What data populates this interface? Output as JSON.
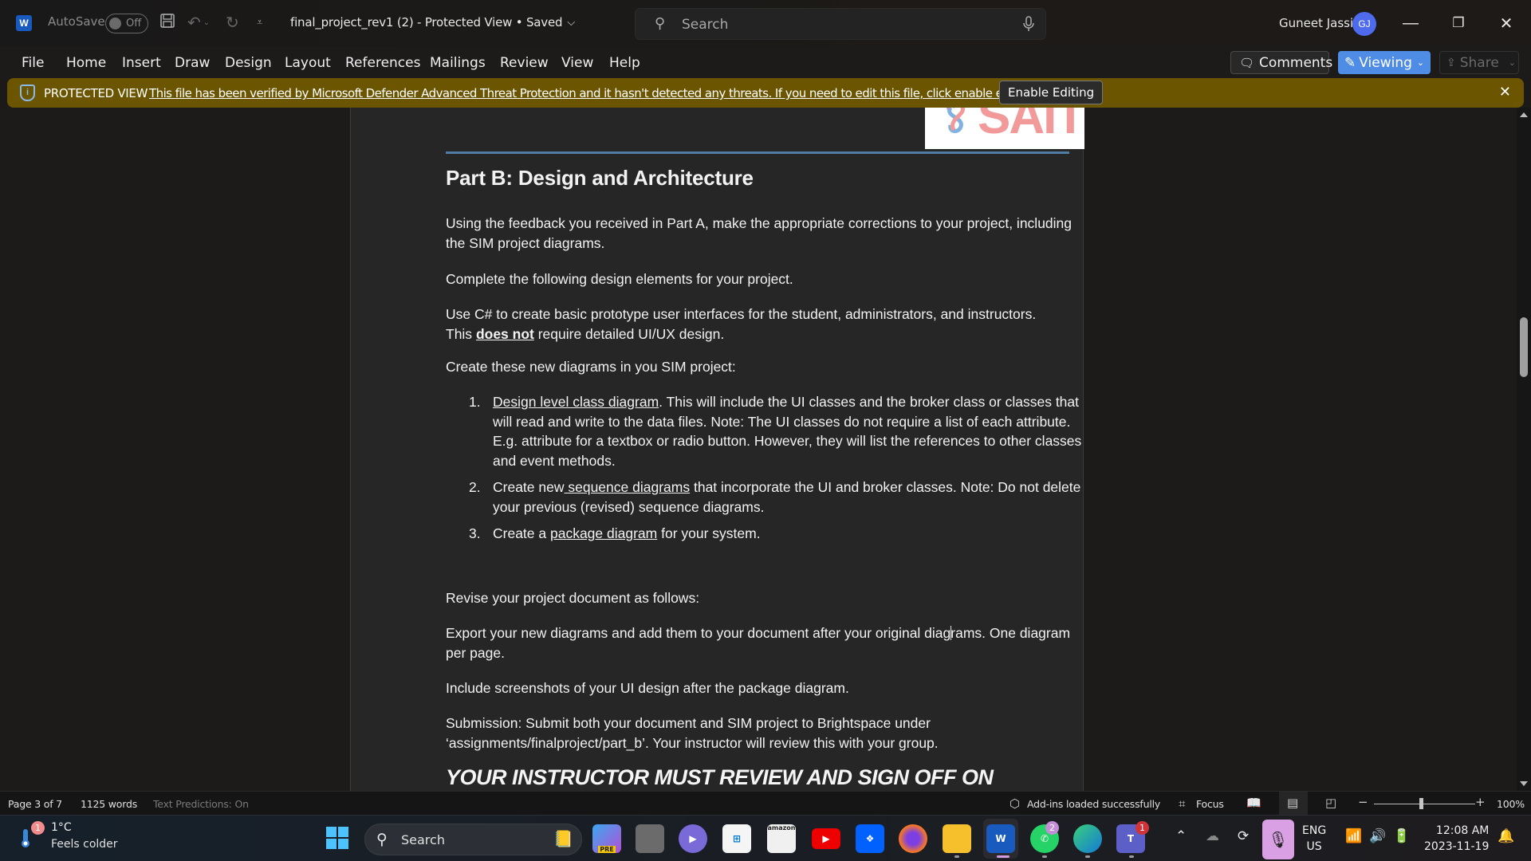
{
  "titlebar": {
    "app_icon": "word-logo-icon",
    "autosave_label": "AutoSave",
    "autosave_state": "Off",
    "document_title": "final_project_rev1 (2)  -  Protected View • Saved",
    "search_placeholder": "Search",
    "user_name": "Guneet Jassi",
    "user_initials": "GJ"
  },
  "menu": {
    "items": [
      "File",
      "Home",
      "Insert",
      "Draw",
      "Design",
      "Layout",
      "References",
      "Mailings",
      "Review",
      "View",
      "Help"
    ],
    "comments_label": "Comments",
    "viewing_label": "Viewing",
    "share_label": "Share"
  },
  "protected_view": {
    "title": "PROTECTED VIEW",
    "message": "This file has been verified by Microsoft Defender Advanced Threat Protection and it hasn't detected any threats. If you need to edit this file, click enable editing.",
    "enable_button": "Enable Editing",
    "bar_color": "#6b5500"
  },
  "document": {
    "logo_text": "SAIT",
    "heading": "Part B: Design and Architecture",
    "p1": "Using the feedback you received in Part A, make the appropriate corrections to your project, including the SIM project diagrams.",
    "p2": "Complete the following design elements for your project.",
    "p3_line1": "Use C# to create basic prototype user interfaces for the student, administrators, and instructors.",
    "p3_this": "This ",
    "p3_bold": "does not",
    "p3_rest": " require detailed UI/UX design.",
    "p4": "Create these new diagrams in you SIM project:",
    "list": [
      {
        "num": "1.",
        "link": "Design level class diagram",
        "rest": ". This will include the UI classes and the broker class or classes that will read and write to the data files. Note: The UI classes do not require a list of each attribute. E.g. attribute for a textbox or radio button. However, they will list the references to other classes and event methods."
      },
      {
        "num": "2.",
        "pre": "Create new",
        "link": " sequence diagrams",
        "rest": " that incorporate the UI and broker classes. Note: Do not delete your previous (revised) sequence diagrams."
      },
      {
        "num": "3.",
        "pre": "Create a ",
        "link": "package diagram",
        "rest": " for your system."
      }
    ],
    "p5": "Revise your project document as follows:",
    "p6_a": "Export your new diagrams and add them to your document after your original diag",
    "p6_b": "rams. One diagram per page.",
    "p7": "Include screenshots of your UI design after the package diagram.",
    "p8": "Submission: Submit both your document and SIM project to Brightspace under ‘assignments/finalproject/part_b’. Your instructor will review this with your group.",
    "p9": "YOUR INSTRUCTOR MUST REVIEW AND SIGN OFF ON"
  },
  "statusbar": {
    "page": "Page 3 of 7",
    "words": "1125 words",
    "predictions": "Text Predictions: On",
    "addins": "Add-ins loaded successfully",
    "focus": "Focus",
    "zoom_level": "100%",
    "zoom_percent": 100
  },
  "taskbar": {
    "weather_temp": "1°C",
    "weather_desc": "Feels colder",
    "weather_badge": "1",
    "search_label": "Search",
    "apps": [
      {
        "name": "copilot",
        "label": "PRE"
      },
      {
        "name": "task-view",
        "label": ""
      },
      {
        "name": "clipchamp",
        "label": ""
      },
      {
        "name": "microsoft-store",
        "label": ""
      },
      {
        "name": "amazon",
        "label": "amazon"
      },
      {
        "name": "youtube",
        "label": ""
      },
      {
        "name": "dropbox",
        "label": ""
      },
      {
        "name": "firefox",
        "label": ""
      },
      {
        "name": "file-explorer",
        "label": ""
      },
      {
        "name": "word",
        "label": "W"
      },
      {
        "name": "whatsapp",
        "label": "",
        "badge": "2"
      },
      {
        "name": "edge",
        "label": ""
      },
      {
        "name": "teams",
        "label": "T",
        "badge": "1"
      }
    ],
    "lang_top": "ENG",
    "lang_bottom": "US",
    "time": "12:08 AM",
    "date": "2023-11-19"
  }
}
